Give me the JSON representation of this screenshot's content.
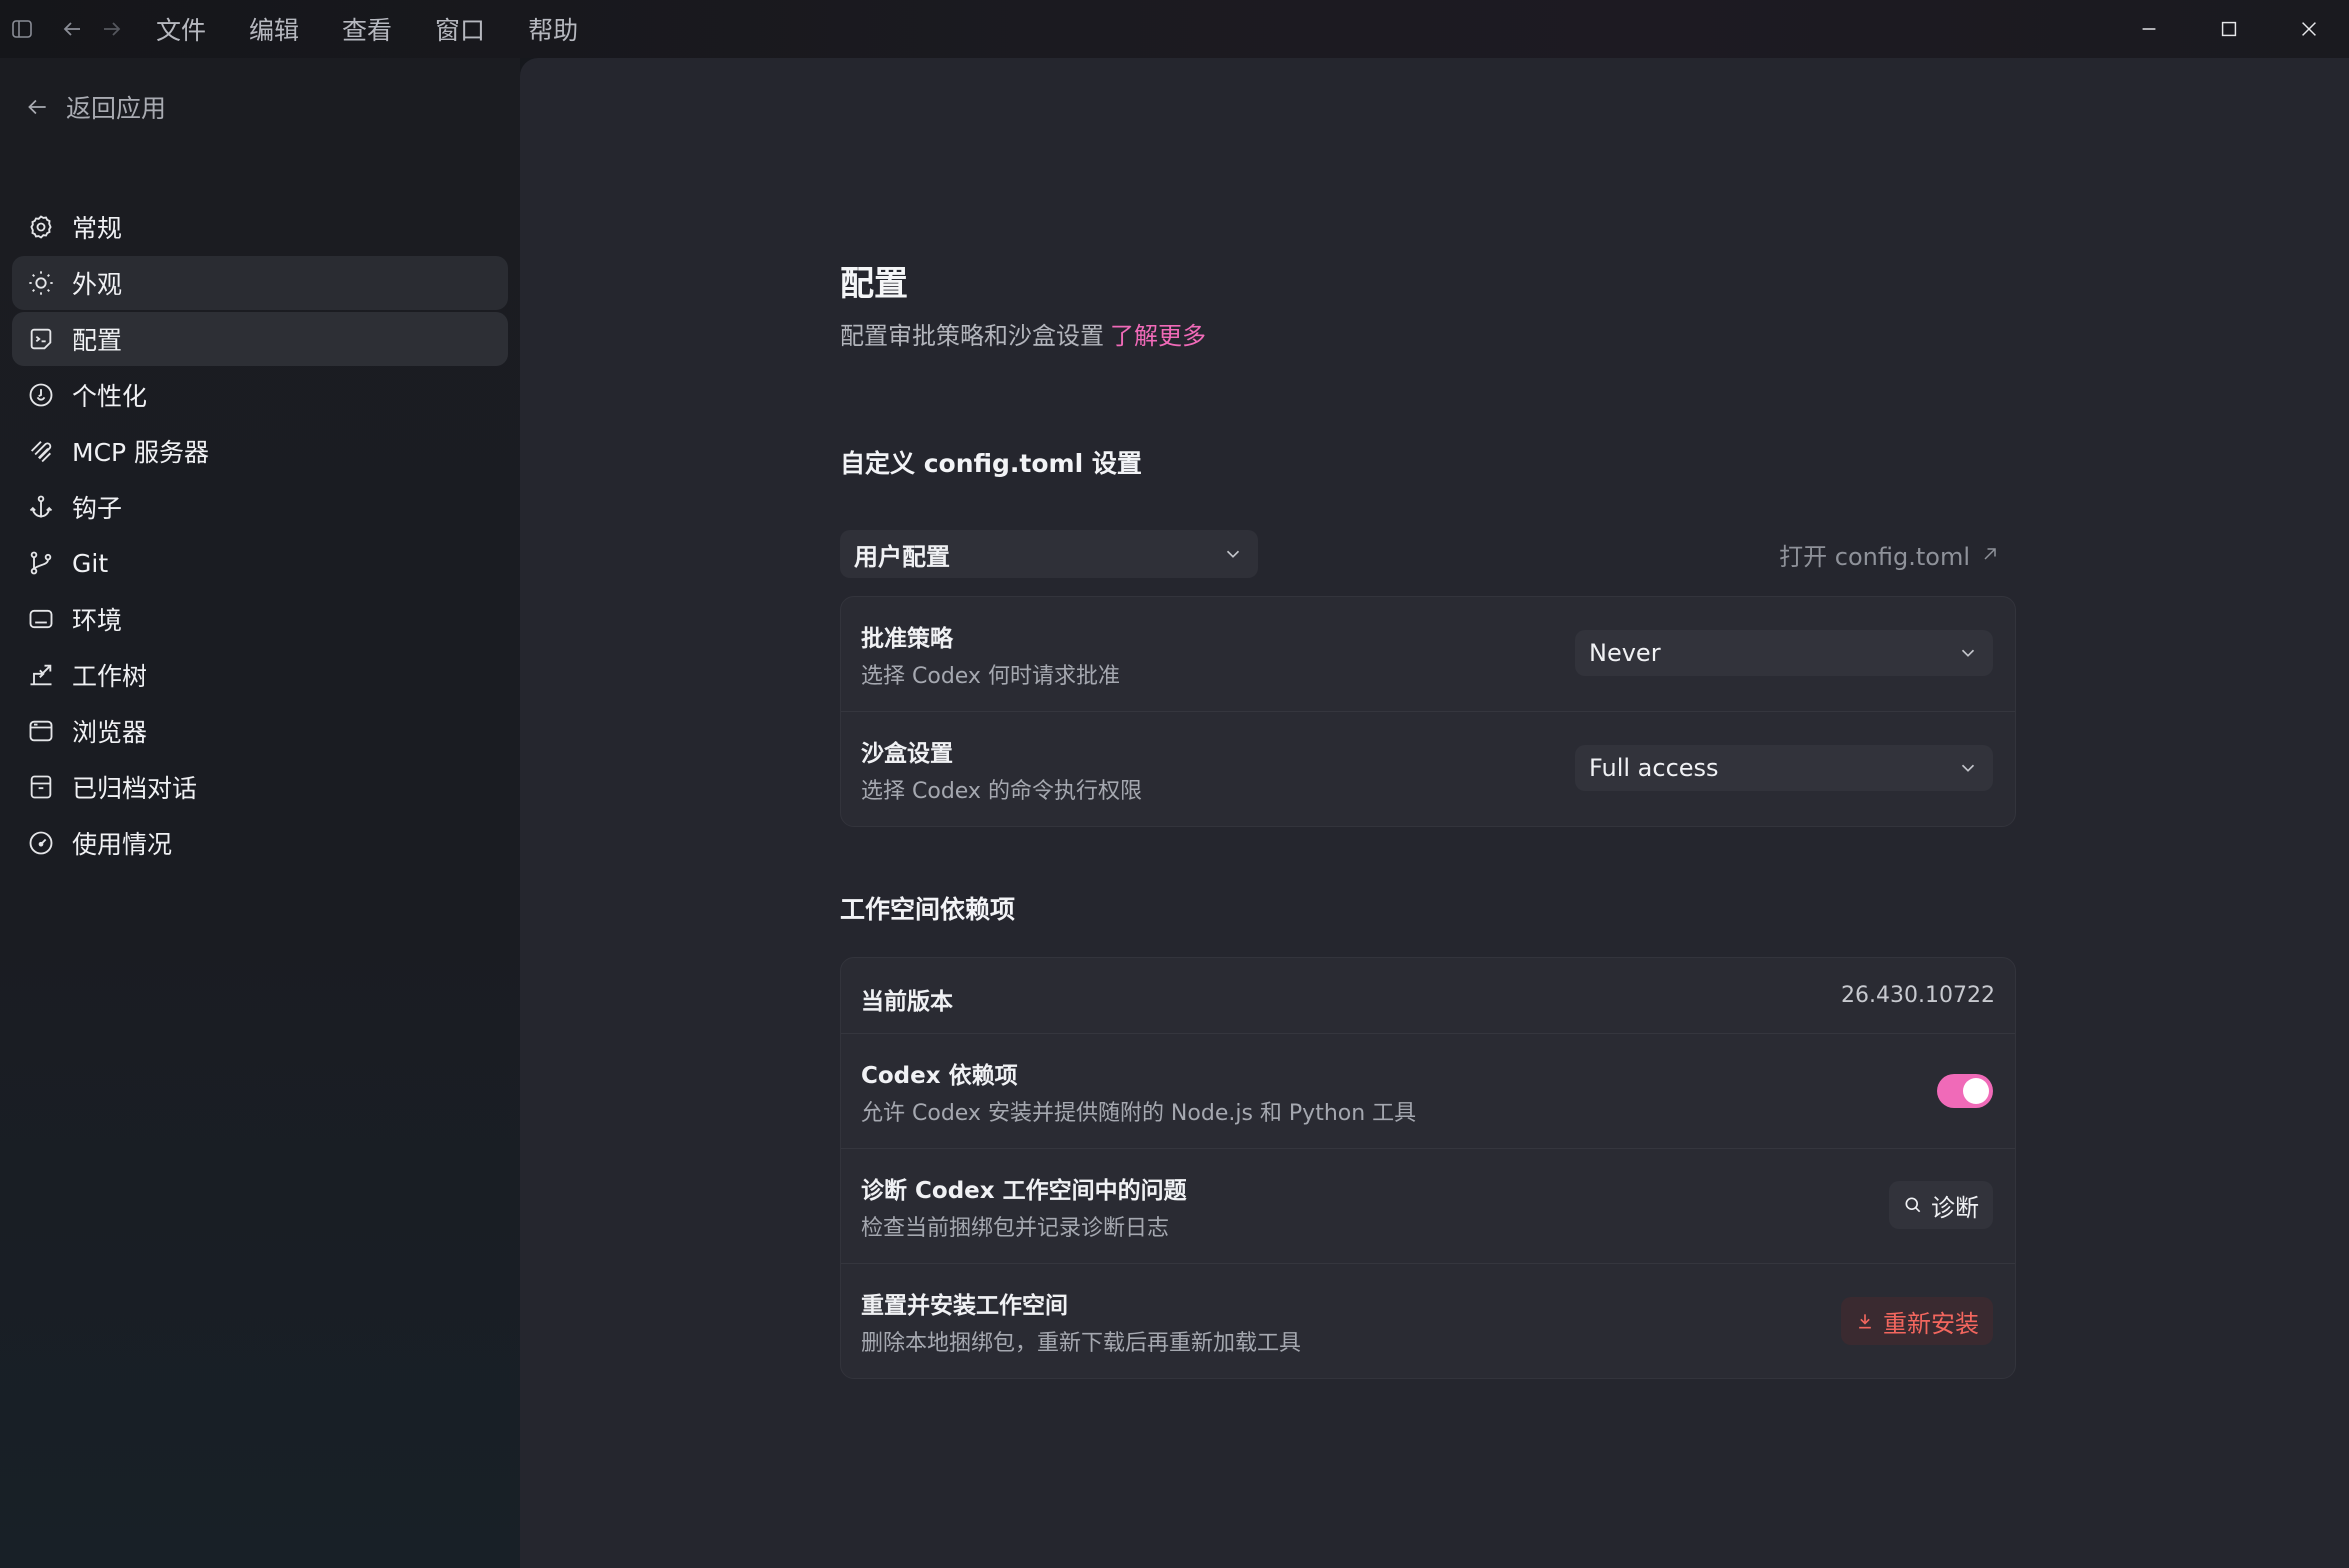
{
  "menu": [
    "文件",
    "编辑",
    "查看",
    "窗口",
    "帮助"
  ],
  "sidebar": {
    "back_label": "返回应用",
    "items": [
      {
        "label": "常规",
        "icon": "gear-icon"
      },
      {
        "label": "外观",
        "icon": "sun-icon"
      },
      {
        "label": "配置",
        "icon": "config-icon"
      },
      {
        "label": "个性化",
        "icon": "personalize-icon"
      },
      {
        "label": "MCP 服务器",
        "icon": "mcp-icon"
      },
      {
        "label": "钩子",
        "icon": "hook-icon"
      },
      {
        "label": "Git",
        "icon": "git-branch-icon"
      },
      {
        "label": "环境",
        "icon": "environment-icon"
      },
      {
        "label": "工作树",
        "icon": "worktree-icon"
      },
      {
        "label": "浏览器",
        "icon": "browser-icon"
      },
      {
        "label": "已归档对话",
        "icon": "archive-icon"
      },
      {
        "label": "使用情况",
        "icon": "gauge-icon"
      }
    ],
    "active_index": 2,
    "hover_index": 1
  },
  "page": {
    "title": "配置",
    "subtitle": "配置审批策略和沙盒设置",
    "learn_more": "了解更多"
  },
  "config_section": {
    "title": "自定义 config.toml 设置",
    "scope_value": "用户配置",
    "open_link": "打开 config.toml",
    "rows": [
      {
        "title": "批准策略",
        "desc": "选择 Codex 何时请求批准",
        "value": "Never"
      },
      {
        "title": "沙盒设置",
        "desc": "选择 Codex 的命令执行权限",
        "value": "Full access"
      }
    ]
  },
  "workspace_section": {
    "title": "工作空间依赖项",
    "version_label": "当前版本",
    "version_value": "26.430.10722",
    "deps_title": "Codex 依赖项",
    "deps_desc": "允许 Codex 安装并提供随附的 Node.js 和 Python 工具",
    "deps_enabled": true,
    "diag_title": "诊断 Codex 工作空间中的问题",
    "diag_desc": "检查当前捆绑包并记录诊断日志",
    "diag_button": "诊断",
    "reset_title": "重置并安装工作空间",
    "reset_desc": "删除本地捆绑包，重新下载后再重新加载工具",
    "reset_button": "重新安装"
  },
  "colors": {
    "accent": "#f06ab8",
    "danger": "#f2665e"
  }
}
